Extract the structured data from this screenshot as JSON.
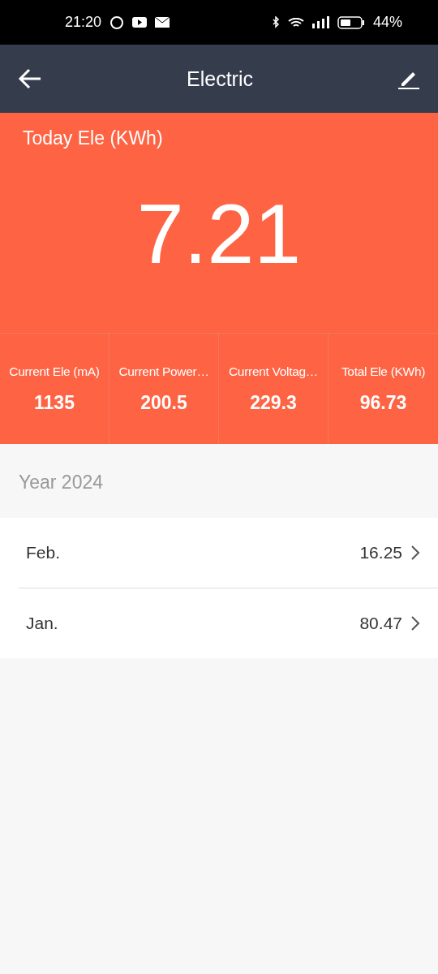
{
  "status_bar": {
    "time": "21:20",
    "battery": "44%"
  },
  "header": {
    "title": "Electric"
  },
  "today": {
    "label": "Today Ele (KWh)",
    "value": "7.21"
  },
  "stats": [
    {
      "label": "Current Ele (mA)",
      "value": "1135"
    },
    {
      "label": "Current Power…",
      "value": "200.5"
    },
    {
      "label": "Current Voltag…",
      "value": "229.3"
    },
    {
      "label": "Total Ele (KWh)",
      "value": "96.73"
    }
  ],
  "year": {
    "label": "Year 2024"
  },
  "months": [
    {
      "name": "Feb.",
      "value": "16.25"
    },
    {
      "name": "Jan.",
      "value": "80.47"
    }
  ]
}
